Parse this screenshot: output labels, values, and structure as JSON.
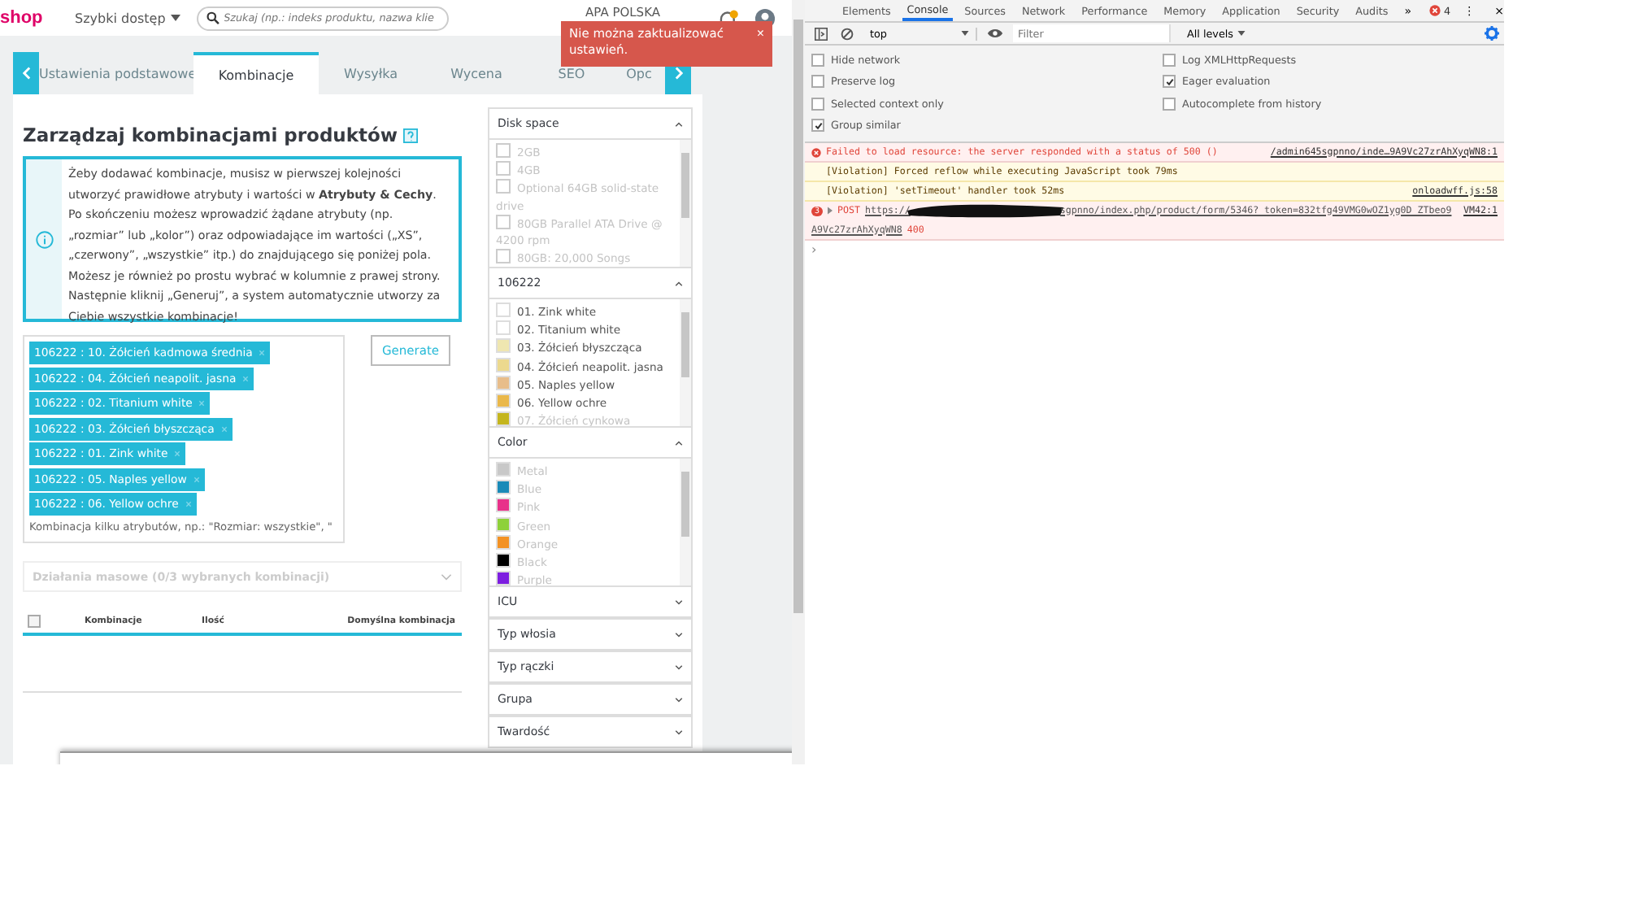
{
  "header": {
    "logo": "shop",
    "quick_access": "Szybki dostęp",
    "search": {
      "placeholder": "Szukaj (np.: indeks produktu, nazwa klie"
    },
    "shop_name": "APA POLSKA"
  },
  "toast": {
    "message": "Nie można zaktualizować ustawień.",
    "close": "×"
  },
  "tabs": [
    {
      "label": "Ustawienia podstawowe",
      "selected": false
    },
    {
      "label": "Kombinacje",
      "selected": true
    },
    {
      "label": "Wysyłka",
      "selected": false
    },
    {
      "label": "Wycena",
      "selected": false
    },
    {
      "label": "SEO",
      "selected": false
    },
    {
      "label": "Opc",
      "selected": false
    }
  ],
  "heading": "Zarządzaj kombinacjami produktów",
  "info": [
    "Żeby dodawać kombinacje, musisz w pierwszej kolejności utworzyć prawidłowe atrybuty i wartości w **Atrybuty & Cechy**.",
    "Po skończeniu możesz wprowadzić żądane atrybuty (np. „rozmiar” lub „kolor”) oraz odpowiadające im wartości („XS”, „czerwony”, „wszystkie” itp.) do znajdującego się poniżej pola. Możesz je również po prostu wybrać w kolumnie z prawej strony. Następnie kliknij „Generuj”, a system automatycznie utworzy za Ciebie wszystkie kombinacje!"
  ],
  "tags": [
    "106222 : 10. Żółcień kadmowa średnia",
    "106222 : 04. Żółcień neapolit. jasna",
    "106222 : 02. Titanium white",
    "106222 : 03. Żółcień błyszcząca",
    "106222 : 01. Zink white",
    "106222 : 05. Naples yellow",
    "106222 : 06. Yellow ochre"
  ],
  "tags_hint": "Kombinacja kilku atrybutów, np.: \"Rozmiar: wszystkie\", \"",
  "generate": "Generate",
  "bulk_actions": {
    "label": "Działania masowe (0/3 wybranych kombinacji)",
    "disabled": true
  },
  "table": {
    "select_all": {
      "checked": false
    },
    "columns": [
      "Kombinacje",
      "Ilość",
      "Domyślna kombinacja"
    ]
  },
  "filters": [
    {
      "title": "Disk space",
      "expanded": true,
      "options": [
        {
          "kind": "checkbox",
          "label": "2GB",
          "disabled": true
        },
        {
          "kind": "checkbox",
          "label": "4GB",
          "disabled": true
        },
        {
          "kind": "checkbox",
          "label": "Optional 64GB solid-state drive",
          "disabled": true
        },
        {
          "kind": "checkbox",
          "label": "80GB Parallel ATA Drive @ 4200 rpm",
          "disabled": true
        },
        {
          "kind": "checkbox",
          "label": "80GB: 20,000 Songs",
          "disabled": true
        }
      ]
    },
    {
      "title": "106222",
      "expanded": true,
      "options": [
        {
          "kind": "swatch",
          "label": "01. Zink white",
          "color": "#ffffff",
          "disabled": false
        },
        {
          "kind": "swatch",
          "label": "02. Titanium white",
          "color": "#ffffff",
          "disabled": false
        },
        {
          "kind": "swatch",
          "label": "03. Żółcień błyszcząca",
          "color": "#efe6b0",
          "disabled": false
        },
        {
          "kind": "swatch",
          "label": "04. Żółcień neapolit. jasna",
          "color": "#ecd98e",
          "disabled": false
        },
        {
          "kind": "swatch",
          "label": "05. Naples yellow",
          "color": "#e8bd8a",
          "disabled": false
        },
        {
          "kind": "swatch",
          "label": "06. Yellow ochre",
          "color": "#eab84a",
          "disabled": false
        },
        {
          "kind": "swatch",
          "label": "07. Żółcień cynkowa",
          "color": "#c4b51e",
          "disabled": true
        }
      ]
    },
    {
      "title": "Color",
      "expanded": true,
      "options": [
        {
          "kind": "swatch",
          "label": "Metal",
          "color": "#c8c8c8",
          "disabled": true
        },
        {
          "kind": "swatch",
          "label": "Blue",
          "color": "#1a8ab8",
          "disabled": true
        },
        {
          "kind": "swatch",
          "label": "Pink",
          "color": "#e8318a",
          "disabled": true
        },
        {
          "kind": "swatch",
          "label": "Green",
          "color": "#8ed13a",
          "disabled": true
        },
        {
          "kind": "swatch",
          "label": "Orange",
          "color": "#f39224",
          "disabled": true
        },
        {
          "kind": "swatch",
          "label": "Black",
          "color": "#000000",
          "disabled": true
        },
        {
          "kind": "swatch",
          "label": "Purple",
          "color": "#7d1ee0",
          "disabled": true
        }
      ]
    },
    {
      "title": "ICU",
      "expanded": false
    },
    {
      "title": "Typ włosia",
      "expanded": false
    },
    {
      "title": "Typ rączki",
      "expanded": false
    },
    {
      "title": "Grupa",
      "expanded": false
    },
    {
      "title": "Twardość",
      "expanded": false
    }
  ],
  "devtools": {
    "tabs": [
      {
        "label": "Elements",
        "selected": false
      },
      {
        "label": "Console",
        "selected": true
      },
      {
        "label": "Sources",
        "selected": false
      },
      {
        "label": "Network",
        "selected": false
      },
      {
        "label": "Performance",
        "selected": false
      },
      {
        "label": "Memory",
        "selected": false
      },
      {
        "label": "Application",
        "selected": false
      },
      {
        "label": "Security",
        "selected": false
      },
      {
        "label": "Audits",
        "selected": false
      }
    ],
    "more": "»",
    "error_count": "4",
    "menu": "⋮",
    "close": "×",
    "context": "top",
    "filter": {
      "placeholder": "Filter"
    },
    "levels": "All levels",
    "settings": [
      {
        "label": "Hide network",
        "checked": false
      },
      {
        "label": "Log XMLHttpRequests",
        "checked": false
      },
      {
        "label": "Preserve log",
        "checked": false
      },
      {
        "label": "Eager evaluation",
        "checked": true
      },
      {
        "label": "Selected context only",
        "checked": false
      },
      {
        "label": "Autocomplete from history",
        "checked": false
      },
      {
        "label": "Group similar",
        "checked": true
      }
    ],
    "messages": [
      {
        "kind": "error",
        "text": "Failed to load resource: the server responded with a status of 500 ()",
        "source": "/admin645sgpnno/inde…9A9Vc27zrAhXyqWN8:1"
      },
      {
        "kind": "warning",
        "text": "[Violation] Forced reflow while executing JavaScript took 79ms"
      },
      {
        "kind": "warning",
        "text": "[Violation] 'setTimeout' handler took 52ms",
        "source": "onloadwff.js:58"
      },
      {
        "kind": "request",
        "count": "3",
        "method": "POST",
        "url_start": "https://",
        "redacted": true,
        "url_end": "sgpnno/index.php/product/form/5346?_token=832tfg49VMG0wOZ1yg0D_ZTbeo9",
        "source": "VM42:1",
        "url_cont": "A9Vc27zrAhXyqWN8",
        "status": "400"
      }
    ],
    "prompt": "›"
  }
}
